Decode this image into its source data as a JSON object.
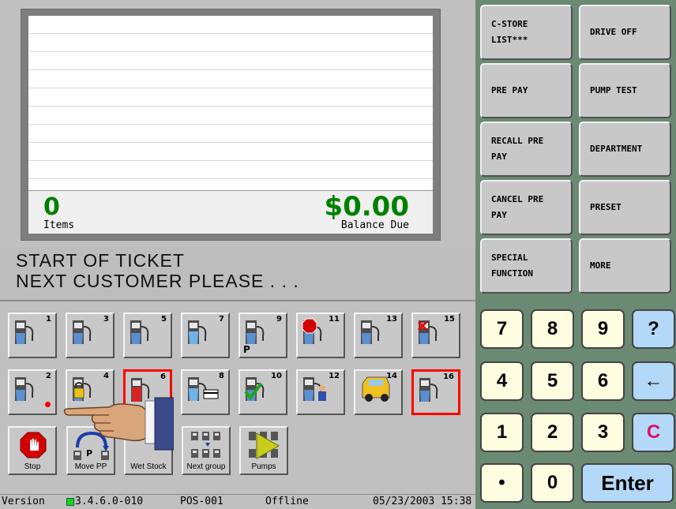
{
  "ticket": {
    "items_count": "0",
    "items_label": "Items",
    "balance_amount": "$0.00",
    "balance_label": "Balance Due"
  },
  "messages": {
    "line1": "START OF TICKET",
    "line2": "NEXT CUSTOMER PLEASE . . ."
  },
  "function_buttons": {
    "cstore_list": [
      "C-STORE",
      "LIST***"
    ],
    "drive_off": "DRIVE OFF",
    "pre_pay": "PRE PAY",
    "pump_test": "PUMP TEST",
    "recall_pre_pay": [
      "RECALL PRE",
      "PAY"
    ],
    "department": "DEPARTMENT",
    "cancel_pre_pay": [
      "CANCEL PRE",
      "PAY"
    ],
    "preset": "PRESET",
    "special_function": [
      "SPECIAL",
      "FUNCTION"
    ],
    "more": "MORE"
  },
  "pumps": [
    {
      "n": "1",
      "state": "idle"
    },
    {
      "n": "3",
      "state": "idle"
    },
    {
      "n": "5",
      "state": "idle"
    },
    {
      "n": "7",
      "state": "fueling"
    },
    {
      "n": "9",
      "state": "prepay",
      "tag": "P"
    },
    {
      "n": "11",
      "state": "stopped"
    },
    {
      "n": "13",
      "state": "idle"
    },
    {
      "n": "15",
      "state": "error"
    },
    {
      "n": "2",
      "state": "idle-dot"
    },
    {
      "n": "4",
      "state": "locked"
    },
    {
      "n": "6",
      "state": "selected-red"
    },
    {
      "n": "8",
      "state": "card"
    },
    {
      "n": "10",
      "state": "approved"
    },
    {
      "n": "12",
      "state": "attendant"
    },
    {
      "n": "14",
      "state": "drive-off"
    },
    {
      "n": "16",
      "state": "selected-idle"
    }
  ],
  "ops": {
    "stop": "Stop",
    "move_pp": "Move PP",
    "move_pp_tag": "P",
    "wet_stock": "Wet Stock",
    "next_group": "Next group",
    "pumps": "Pumps"
  },
  "status": {
    "version_prefix": "Version ",
    "version_number": "3.4.6.0-010",
    "pos": "POS-001",
    "mode": "Offline",
    "datetime": "05/23/2003 15:38"
  },
  "keypad": {
    "k7": "7",
    "k8": "8",
    "k9": "9",
    "help": "?",
    "k4": "4",
    "k5": "5",
    "k6": "6",
    "back": "←",
    "k1": "1",
    "k2": "2",
    "k3": "3",
    "clear": "C",
    "dot": "•",
    "k0": "0",
    "enter": "Enter"
  },
  "colors": {
    "money_green": "#008000",
    "panel_green": "#6b8a73",
    "selected_border": "#ff0000",
    "clear_red": "#e0115f"
  }
}
